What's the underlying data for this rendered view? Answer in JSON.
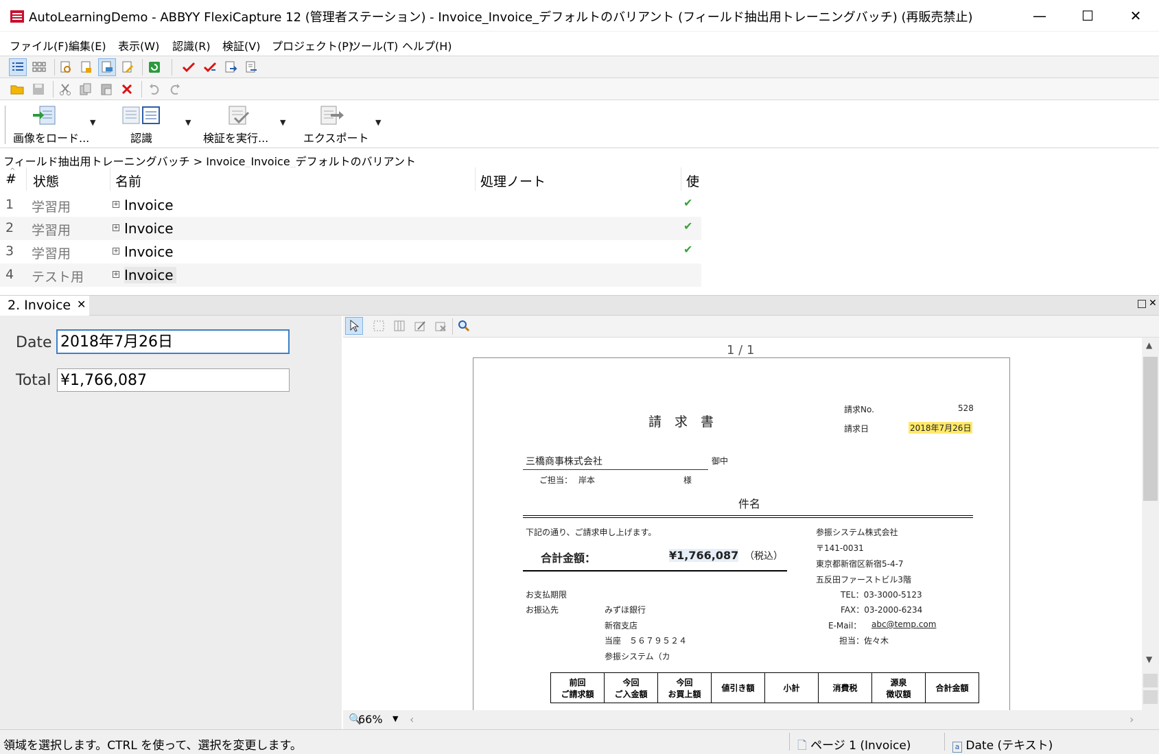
{
  "window": {
    "title": "AutoLearningDemo - ABBYY FlexiCapture 12 (管理者ステーション) - Invoice_Invoice_デフォルトのバリアント (フィールド抽出用トレーニングバッチ) (再販売禁止)",
    "minimize": "—",
    "maximize": "☐",
    "close": "✕"
  },
  "menu": [
    "ファイル(F)",
    "編集(E)",
    "表示(W)",
    "認識(R)",
    "検証(V)",
    "プロジェクト(P)",
    "ツール(T)",
    "ヘルプ(H)"
  ],
  "big_toolbar": {
    "load": "画像をロード...",
    "recognize": "認識",
    "verify": "検証を実行...",
    "export": "エクスポート",
    "dropdown": "▼"
  },
  "breadcrumb": "フィールド抽出用トレーニングバッチ   >   Invoice_Invoice_デフォルトのバリアント",
  "doclist": {
    "columns": [
      "#",
      "状態",
      "名前",
      "処理ノート",
      "使"
    ],
    "rows": [
      {
        "num": "1",
        "status": "学習用",
        "name": "Invoice",
        "used": true
      },
      {
        "num": "2",
        "status": "学習用",
        "name": "Invoice",
        "used": true
      },
      {
        "num": "3",
        "status": "学習用",
        "name": "Invoice",
        "used": true
      },
      {
        "num": "4",
        "status": "テスト用",
        "name": "Invoice",
        "used": false
      }
    ],
    "expand": "+",
    "check": "✔"
  },
  "doc_tab": {
    "label": "2. Invoice",
    "close": "✕"
  },
  "fields": {
    "date_label": "Date",
    "date_value": "2018年7月26日",
    "total_label": "Total",
    "total_value": "¥1,766,087"
  },
  "image_view": {
    "page_counter": "1 / 1",
    "zoom": "66%",
    "zoom_dd": "▼"
  },
  "invoice": {
    "title": "請　求　書",
    "no_label": "請求No.",
    "no_value": "528",
    "date_label": "請求日",
    "date_value": "2018年7月26日",
    "customer": "三橋商事株式会社",
    "onchu": "御中",
    "tanto_label": "ご担当：",
    "tanto_name": "岸本",
    "sama": "様",
    "subject": "件名",
    "intro": "下記の通り、ご請求申し上げます。",
    "total_label": "合計金額：",
    "total_value": "¥1,766,087",
    "tax_note": "（税込）",
    "due_label": "お支払期限",
    "bank_label": "お振込先",
    "bank_name": "みずほ銀行",
    "branch": "新宿支店",
    "account": "当座　５６７９５２４",
    "holder": "参振システム（カ",
    "company": "参振システム株式会社",
    "zip": "〒141-0031",
    "addr1": "東京都新宿区新宿5-4-7",
    "addr2": "五反田ファーストビル3階",
    "tel": "TEL：03-3000-5123",
    "fax": "FAX：03-2000-6234",
    "email_label": "E-Mail：",
    "email": "abc@temp.com",
    "staff": "担当：佐々木",
    "table_headers": [
      [
        "前回",
        "ご請求額"
      ],
      [
        "今回",
        "ご入金額"
      ],
      [
        "今回",
        "お買上額"
      ],
      [
        "値引き額"
      ],
      [
        "小計"
      ],
      [
        "消費税"
      ],
      [
        "源泉",
        "徴収額"
      ],
      [
        "合計金額"
      ]
    ]
  },
  "status": {
    "hint": "領域を選択します。CTRL を使って、選択を変更します。",
    "page": "ページ 1 (Invoice)",
    "field": "Date (テキスト)"
  },
  "colors": {
    "accent": "#3a7fc8",
    "check": "#3aa23a",
    "highlight": "#ffe96b"
  }
}
